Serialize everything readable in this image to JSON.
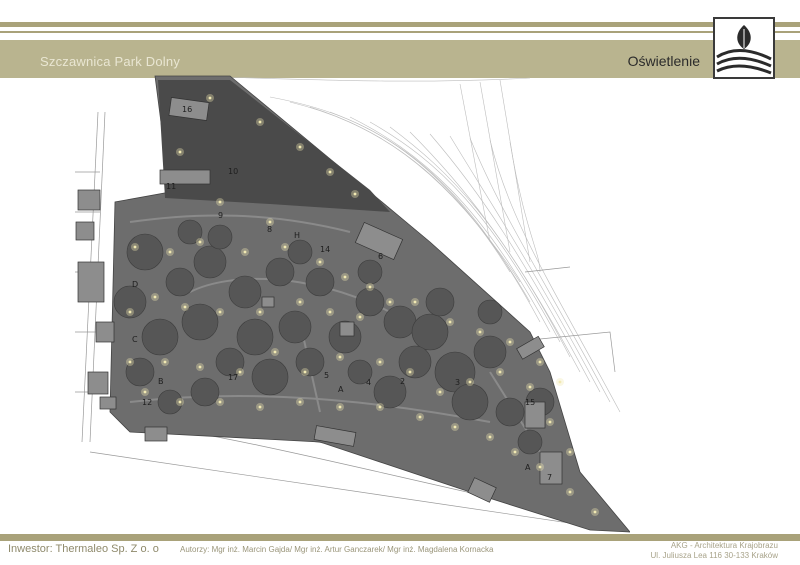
{
  "header": {
    "project_title": "Szczawnica Park Dolny",
    "sheet_title": "Oświetlenie"
  },
  "logo": {
    "icon": "leaf-over-hills-logo-icon"
  },
  "map": {
    "labels": {
      "area_16": "16",
      "area_10": "10",
      "area_11": "11",
      "area_9": "9",
      "area_14": "14",
      "area_8": "8",
      "area_h": "H",
      "area_d": "D",
      "area_c": "C",
      "area_b": "B",
      "area_12": "12",
      "area_17": "17",
      "area_5": "5",
      "area_a1": "A",
      "area_4": "4",
      "area_2": "2",
      "area_3": "3",
      "area_6": "6",
      "area_15": "15",
      "area_a2": "A",
      "area_7": "7"
    },
    "colors": {
      "park_fill": "#6d6d6d",
      "lake_fill": "#4a4a4a",
      "tree_fill": "#565656",
      "lamp_glow": "#f1e9b3",
      "contour_line": "#bdbdbd"
    }
  },
  "footer": {
    "investor": "Inwestor: Thermaleo Sp. Z o. o",
    "authors": "Autorzy: Mgr inż. Marcin Gajda/ Mgr inż. Artur Ganczarek/ Mgr inż. Magdalena Kornacka",
    "firm_name": "AKG - Architektura Krajobrazu",
    "firm_address": "Ul. Juliusza Lea 116 30-133 Kraków"
  }
}
